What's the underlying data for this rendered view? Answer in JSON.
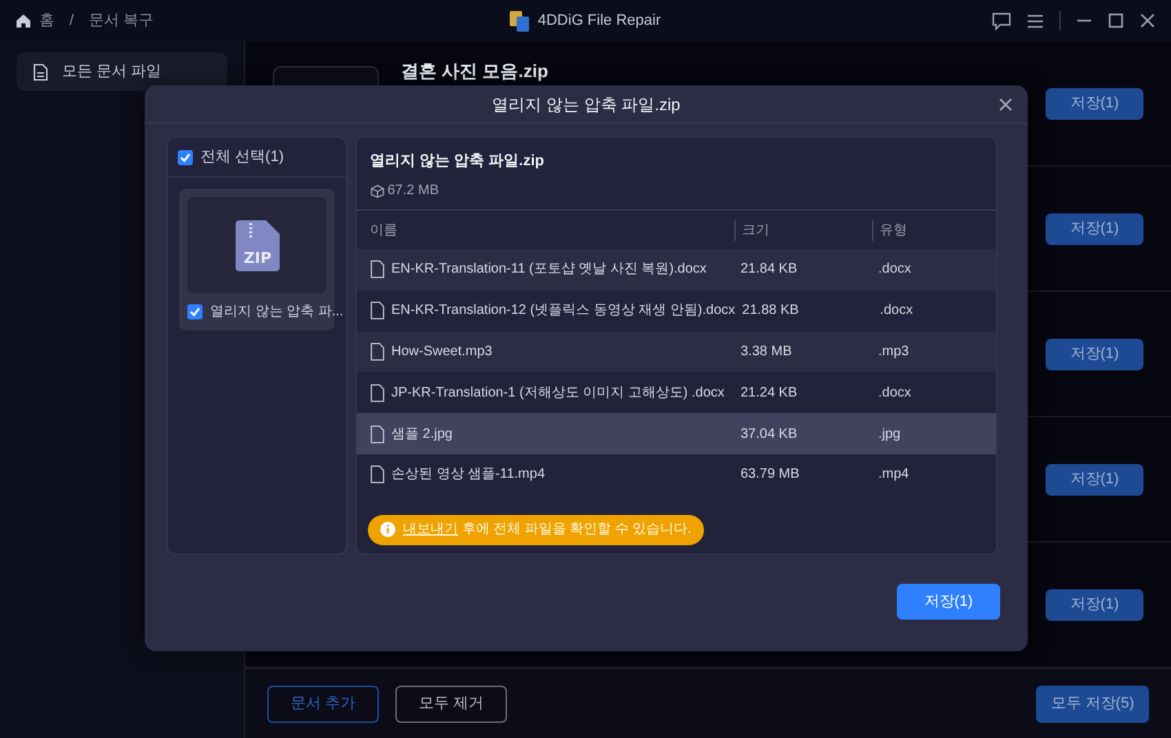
{
  "titlebar": {
    "breadcrumb": [
      "홈",
      "문서 복구"
    ],
    "separator": "/",
    "app_title": "4DDiG File Repair"
  },
  "sidebar": {
    "items": [
      {
        "label": "모든 문서 파일",
        "selected": true
      }
    ]
  },
  "files": [
    {
      "title": "결혼 사진 모음.zip",
      "button": "저장(1)"
    },
    {
      "button": "저장(1)"
    },
    {
      "button": "저장(1)"
    },
    {
      "button": "저장(1)"
    },
    {
      "button": "저장(1)"
    }
  ],
  "bottom_bar": {
    "add_button": "문서 추가",
    "remove_button": "모두 제거",
    "save_all_button": "모두 저장(5)"
  },
  "dialog": {
    "title": "열리지 않는 압축 파일.zip",
    "left_panel": {
      "select_all": {
        "label": "전체 선택(1)",
        "checked": true
      },
      "archives": [
        {
          "label": "열리지 않는 압축 파...",
          "badge": "ZIP",
          "checked": true
        }
      ]
    },
    "right_panel": {
      "title": "열리지 않는 압축 파일.zip",
      "size": "67.2 MB",
      "table": {
        "columns": [
          "이름",
          "크기",
          "유형"
        ],
        "rows": [
          {
            "name": "EN-KR-Translation-11  (포토샵 옛날 사진 복원).docx",
            "size": "21.84 KB",
            "type": ".docx",
            "highlighted": false
          },
          {
            "name": "EN-KR-Translation-12  (넷플릭스 동영상 재생 안됨).docx",
            "size": "21.88 KB",
            "type": ".docx",
            "highlighted": false
          },
          {
            "name": "How-Sweet.mp3",
            "size": "3.38 MB",
            "type": ".mp3",
            "highlighted": false
          },
          {
            "name": "JP-KR-Translation-1  (저해상도 이미지 고해상도) .docx",
            "size": "21.24 KB",
            "type": ".docx",
            "highlighted": false
          },
          {
            "name": "샘플 2.jpg",
            "size": "37.04 KB",
            "type": ".jpg",
            "highlighted": true
          },
          {
            "name": "손상된 영상 샘플-11.mp4",
            "size": "63.79 MB",
            "type": ".mp4",
            "highlighted": false
          }
        ]
      },
      "notice": {
        "link": "내보내기",
        "text": "후에 전체 파일을 확인할 수 있습니다."
      }
    },
    "save_button": "저장(1)"
  }
}
